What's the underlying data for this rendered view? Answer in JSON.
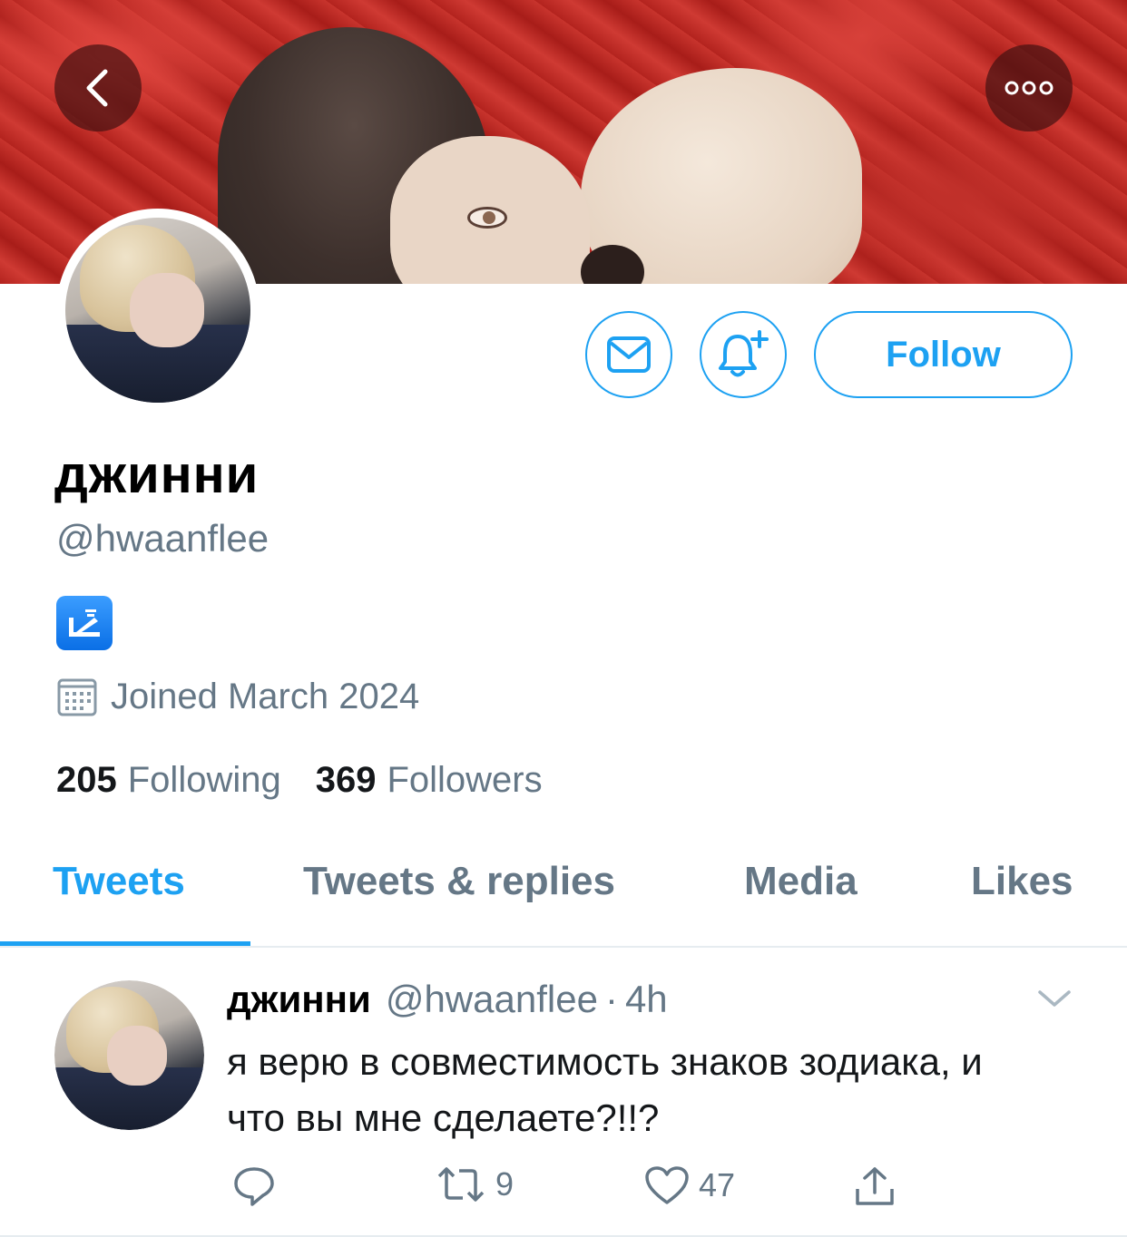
{
  "colors": {
    "accent": "#1da1f2",
    "secondary_text": "#657786",
    "primary_text": "#14171a"
  },
  "icons": {
    "back": "chevron-left-icon",
    "more": "more-icon",
    "message": "envelope-icon",
    "notify": "bell-plus-icon",
    "bio_emoji": "mailbox-emoji-icon",
    "joined": "calendar-icon",
    "caret": "chevron-down-icon",
    "reply": "reply-icon",
    "retweet": "retweet-icon",
    "like": "heart-icon",
    "share": "share-icon"
  },
  "profile": {
    "display_name": "джинни",
    "handle": "@hwaanflee",
    "joined": "Joined March 2024",
    "following_count": "205",
    "following_label": "Following",
    "followers_count": "369",
    "followers_label": "Followers",
    "follow_label": "Follow"
  },
  "tabs": [
    {
      "label": "Tweets",
      "active": true
    },
    {
      "label": "Tweets & replies",
      "active": false
    },
    {
      "label": "Media",
      "active": false
    },
    {
      "label": "Likes",
      "active": false
    }
  ],
  "tweet": {
    "name": "джинни",
    "handle": "@hwaanflee",
    "separator": "·",
    "time": "4h",
    "text": "я верю в совместимость знаков зодиака, и что вы мне сделаете?!!?",
    "retweets": "9",
    "likes": "47"
  }
}
